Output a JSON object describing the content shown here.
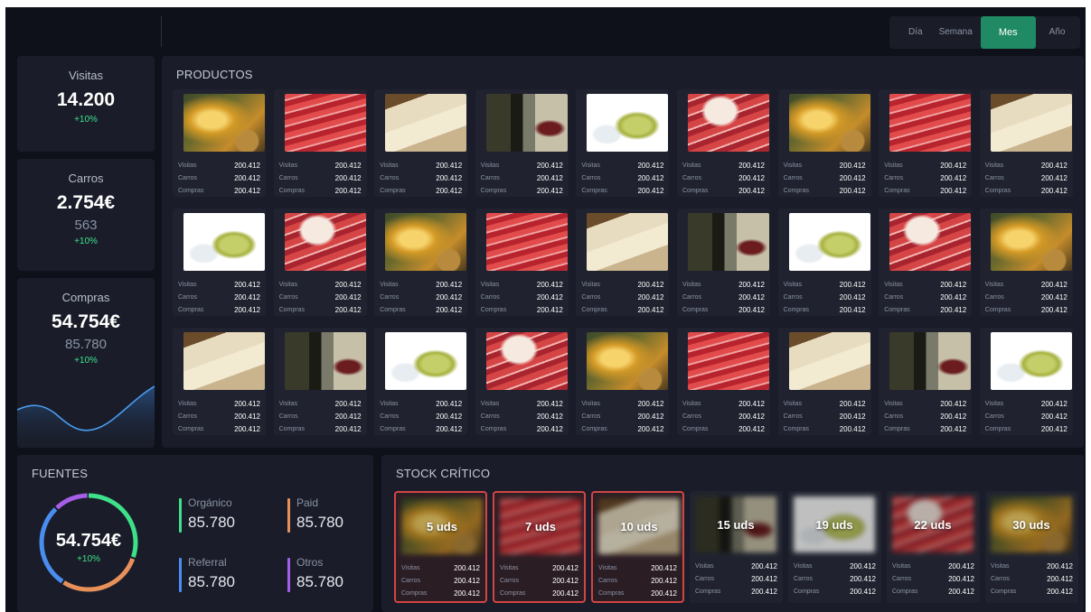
{
  "period": {
    "options": [
      "Día",
      "Semana",
      "Mes",
      "Año"
    ],
    "selected": "Mes"
  },
  "kpis": {
    "visitas": {
      "label": "Visitas",
      "value": "14.200",
      "change": "+10%"
    },
    "carros": {
      "label": "Carros",
      "value": "2.754€",
      "count": "563",
      "change": "+10%"
    },
    "compras": {
      "label": "Compras",
      "value": "54.754€",
      "count": "85.780",
      "change": "+10%"
    }
  },
  "productos": {
    "title": "PRODUCTOS",
    "stat_labels": {
      "visitas": "Visitas",
      "carros": "Carros",
      "compras": "Compras"
    },
    "items": [
      {
        "img": "olive-oil",
        "visitas": "200.412",
        "carros": "200.412",
        "compras": "200.412"
      },
      {
        "img": "jamon",
        "visitas": "200.412",
        "carros": "200.412",
        "compras": "200.412"
      },
      {
        "img": "cheese",
        "visitas": "200.412",
        "carros": "200.412",
        "compras": "200.412"
      },
      {
        "img": "red-wine",
        "visitas": "200.412",
        "carros": "200.412",
        "compras": "200.412"
      },
      {
        "img": "white-wine",
        "visitas": "200.412",
        "carros": "200.412",
        "compras": "200.412"
      },
      {
        "img": "jamon-slices",
        "visitas": "200.412",
        "carros": "200.412",
        "compras": "200.412"
      },
      {
        "img": "olive-oil",
        "visitas": "200.412",
        "carros": "200.412",
        "compras": "200.412"
      },
      {
        "img": "jamon",
        "visitas": "200.412",
        "carros": "200.412",
        "compras": "200.412"
      },
      {
        "img": "cheese",
        "visitas": "200.412",
        "carros": "200.412",
        "compras": "200.412"
      },
      {
        "img": "white-wine",
        "visitas": "200.412",
        "carros": "200.412",
        "compras": "200.412"
      },
      {
        "img": "jamon-slices",
        "visitas": "200.412",
        "carros": "200.412",
        "compras": "200.412"
      },
      {
        "img": "olive-oil",
        "visitas": "200.412",
        "carros": "200.412",
        "compras": "200.412"
      },
      {
        "img": "jamon",
        "visitas": "200.412",
        "carros": "200.412",
        "compras": "200.412"
      },
      {
        "img": "cheese",
        "visitas": "200.412",
        "carros": "200.412",
        "compras": "200.412"
      },
      {
        "img": "red-wine",
        "visitas": "200.412",
        "carros": "200.412",
        "compras": "200.412"
      },
      {
        "img": "white-wine",
        "visitas": "200.412",
        "carros": "200.412",
        "compras": "200.412"
      },
      {
        "img": "jamon-slices",
        "visitas": "200.412",
        "carros": "200.412",
        "compras": "200.412"
      },
      {
        "img": "olive-oil",
        "visitas": "200.412",
        "carros": "200.412",
        "compras": "200.412"
      },
      {
        "img": "cheese",
        "visitas": "200.412",
        "carros": "200.412",
        "compras": "200.412"
      },
      {
        "img": "red-wine",
        "visitas": "200.412",
        "carros": "200.412",
        "compras": "200.412"
      },
      {
        "img": "white-wine",
        "visitas": "200.412",
        "carros": "200.412",
        "compras": "200.412"
      },
      {
        "img": "jamon-slices",
        "visitas": "200.412",
        "carros": "200.412",
        "compras": "200.412"
      },
      {
        "img": "olive-oil",
        "visitas": "200.412",
        "carros": "200.412",
        "compras": "200.412"
      },
      {
        "img": "jamon",
        "visitas": "200.412",
        "carros": "200.412",
        "compras": "200.412"
      },
      {
        "img": "cheese",
        "visitas": "200.412",
        "carros": "200.412",
        "compras": "200.412"
      },
      {
        "img": "red-wine",
        "visitas": "200.412",
        "carros": "200.412",
        "compras": "200.412"
      },
      {
        "img": "white-wine",
        "visitas": "200.412",
        "carros": "200.412",
        "compras": "200.412"
      }
    ]
  },
  "fuentes": {
    "title": "FUENTES",
    "total": "54.754€",
    "change": "+10%",
    "sources": [
      {
        "name": "Orgánico",
        "value": "85.780",
        "color": "#3ee08a"
      },
      {
        "name": "Paid",
        "value": "85.780",
        "color": "#e8905a"
      },
      {
        "name": "Referral",
        "value": "85.780",
        "color": "#4a8df0"
      },
      {
        "name": "Otros",
        "value": "85.780",
        "color": "#a65ee8"
      }
    ]
  },
  "stock": {
    "title": "STOCK CRÍTICO",
    "items": [
      {
        "qty": "5 uds",
        "img": "olive-oil",
        "critical": true,
        "visitas": "200.412",
        "carros": "200.412",
        "compras": "200.412"
      },
      {
        "qty": "7 uds",
        "img": "jamon",
        "critical": true,
        "visitas": "200.412",
        "carros": "200.412",
        "compras": "200.412"
      },
      {
        "qty": "10 uds",
        "img": "cheese",
        "critical": true,
        "visitas": "200.412",
        "carros": "200.412",
        "compras": "200.412"
      },
      {
        "qty": "15 uds",
        "img": "red-wine",
        "critical": false,
        "visitas": "200.412",
        "carros": "200.412",
        "compras": "200.412"
      },
      {
        "qty": "19 uds",
        "img": "white-wine",
        "critical": false,
        "visitas": "200.412",
        "carros": "200.412",
        "compras": "200.412"
      },
      {
        "qty": "22 uds",
        "img": "jamon-slices",
        "critical": false,
        "visitas": "200.412",
        "carros": "200.412",
        "compras": "200.412"
      },
      {
        "qty": "30 uds",
        "img": "olive-oil",
        "critical": false,
        "visitas": "200.412",
        "carros": "200.412",
        "compras": "200.412"
      }
    ]
  }
}
